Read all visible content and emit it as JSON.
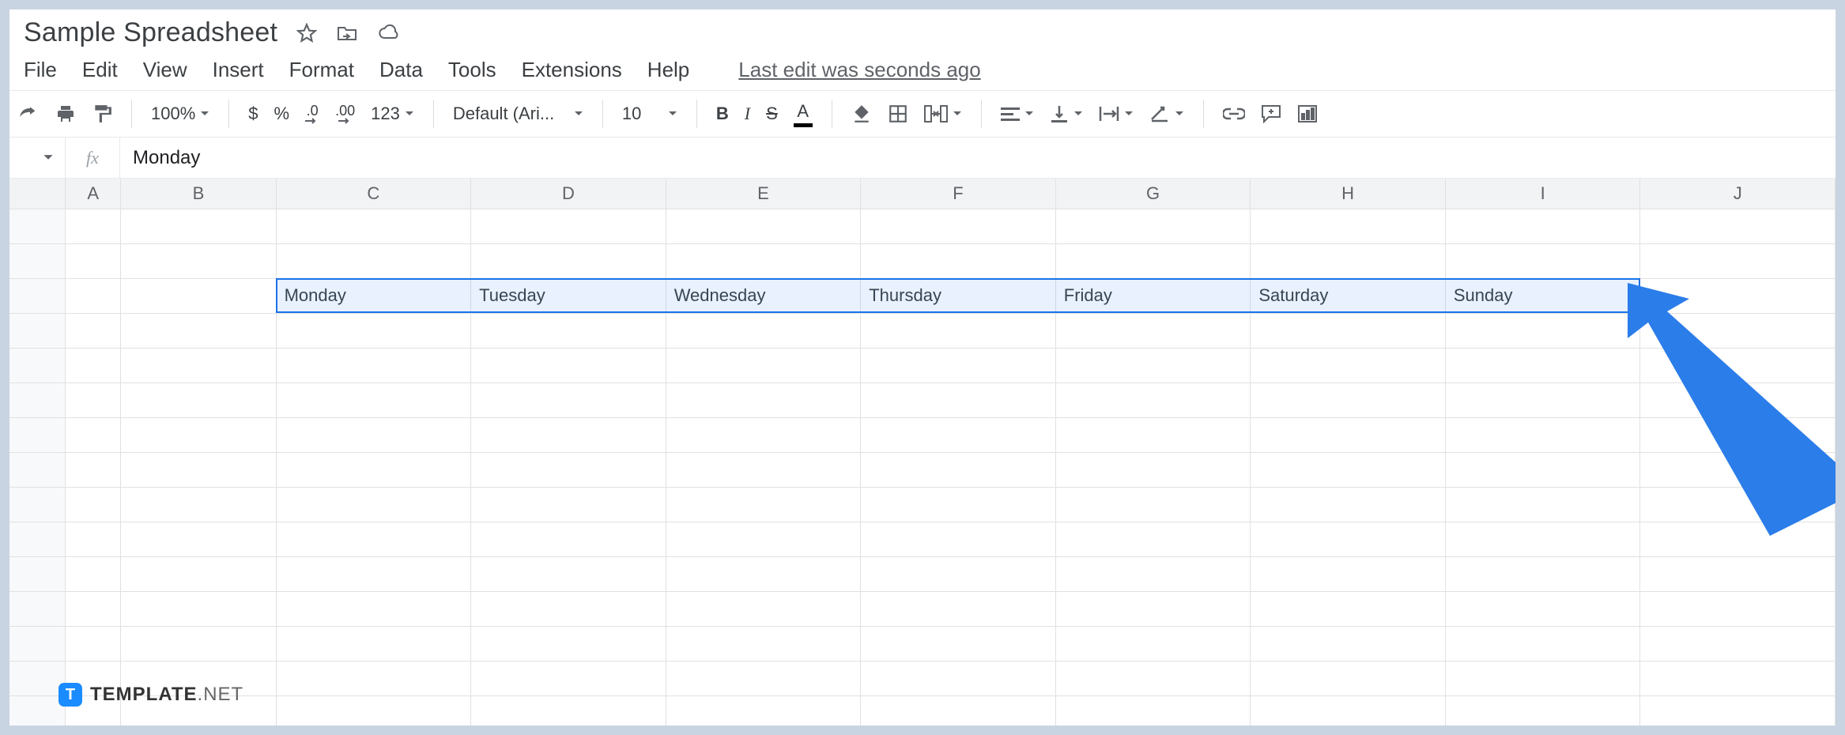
{
  "title": "Sample Spreadsheet",
  "menu": [
    "File",
    "Edit",
    "View",
    "Insert",
    "Format",
    "Data",
    "Tools",
    "Extensions",
    "Help"
  ],
  "last_edit": "Last edit was seconds ago",
  "toolbar": {
    "zoom": "100%",
    "currency": "$",
    "percent": "%",
    "dec_decrease": ".0",
    "dec_increase": ".00",
    "more_formats": "123",
    "font": "Default (Ari...",
    "font_size": "10",
    "bold": "B",
    "italic": "I",
    "strike": "S",
    "text_color": "A"
  },
  "formula_bar": {
    "fx": "fx",
    "value": "Monday"
  },
  "columns": [
    "A",
    "B",
    "C",
    "D",
    "E",
    "F",
    "G",
    "H",
    "I",
    "J"
  ],
  "cells": {
    "row3": [
      "",
      "",
      "Monday",
      "Tuesday",
      "Wednesday",
      "Thursday",
      "Friday",
      "Saturday",
      "Sunday",
      ""
    ]
  },
  "watermark": {
    "badge": "T",
    "brand": "TEMPLATE",
    "suffix": ".NET"
  }
}
